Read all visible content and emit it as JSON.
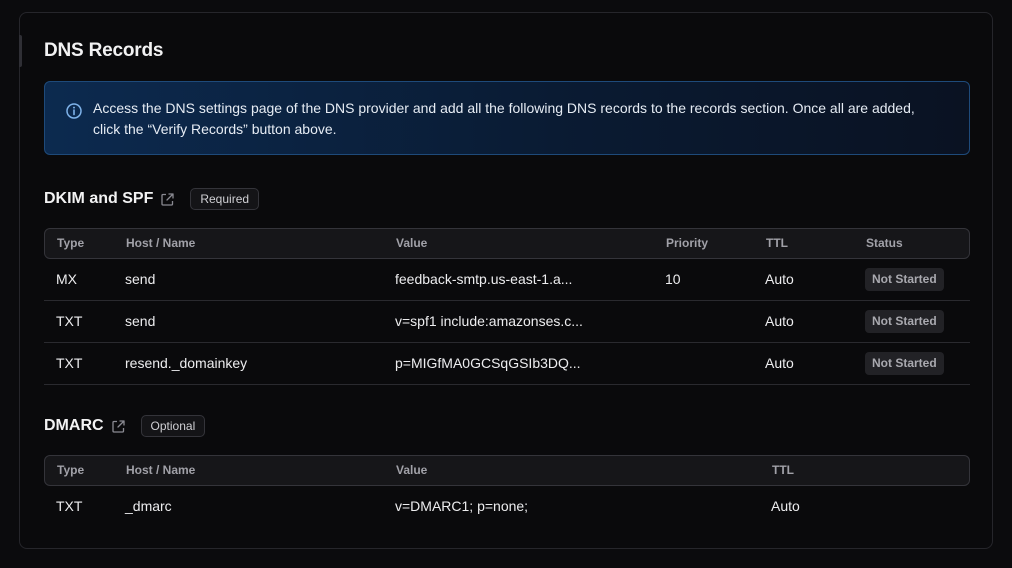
{
  "title": "DNS Records",
  "info_text": "Access the DNS settings page of the DNS provider and add all the following DNS records to the records section. Once all are added, click the “Verify Records” button above.",
  "dkim": {
    "title": "DKIM and SPF",
    "badge": "Required",
    "headers": {
      "type": "Type",
      "host": "Host / Name",
      "value": "Value",
      "priority": "Priority",
      "ttl": "TTL",
      "status": "Status"
    },
    "rows": [
      {
        "type": "MX",
        "host": "send",
        "value": "feedback-smtp.us-east-1.a...",
        "priority": "10",
        "ttl": "Auto",
        "status": "Not Started"
      },
      {
        "type": "TXT",
        "host": "send",
        "value": "v=spf1 include:amazonses.c...",
        "priority": "",
        "ttl": "Auto",
        "status": "Not Started"
      },
      {
        "type": "TXT",
        "host": "resend._domainkey",
        "value": "p=MIGfMA0GCSqGSIb3DQ...",
        "priority": "",
        "ttl": "Auto",
        "status": "Not Started"
      }
    ]
  },
  "dmarc": {
    "title": "DMARC",
    "badge": "Optional",
    "headers": {
      "type": "Type",
      "host": "Host / Name",
      "value": "Value",
      "ttl": "TTL"
    },
    "rows": [
      {
        "type": "TXT",
        "host": "_dmarc",
        "value": "v=DMARC1; p=none;",
        "ttl": "Auto"
      }
    ]
  },
  "icons": {
    "info": "info-circle-icon",
    "external": "external-link-icon"
  },
  "colors": {
    "info_border": "#1e4a7a",
    "info_bg": "#0c2a4f",
    "status_bg": "#222226"
  }
}
